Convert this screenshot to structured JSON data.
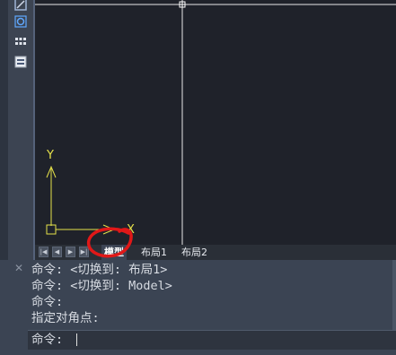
{
  "toolbar": {
    "icons": [
      "edit-icon",
      "circle-snap-icon",
      "grid-icon",
      "image-icon"
    ]
  },
  "canvas": {
    "ucs_y_label": "Y",
    "ucs_x_label": "X"
  },
  "layout_tabs": {
    "nav_buttons": [
      "|◀",
      "◀",
      "▶",
      "▶|"
    ],
    "tabs": [
      {
        "label": "模型",
        "active": true
      },
      {
        "label": "布局1",
        "active": false
      },
      {
        "label": "布局2",
        "active": false
      }
    ]
  },
  "command_window": {
    "close_symbol": "✕",
    "history": [
      "命令: <切换到: 布局1>",
      "命令: <切换到: Model>",
      "命令:",
      "指定对角点:"
    ],
    "prompt": "命令:"
  }
}
